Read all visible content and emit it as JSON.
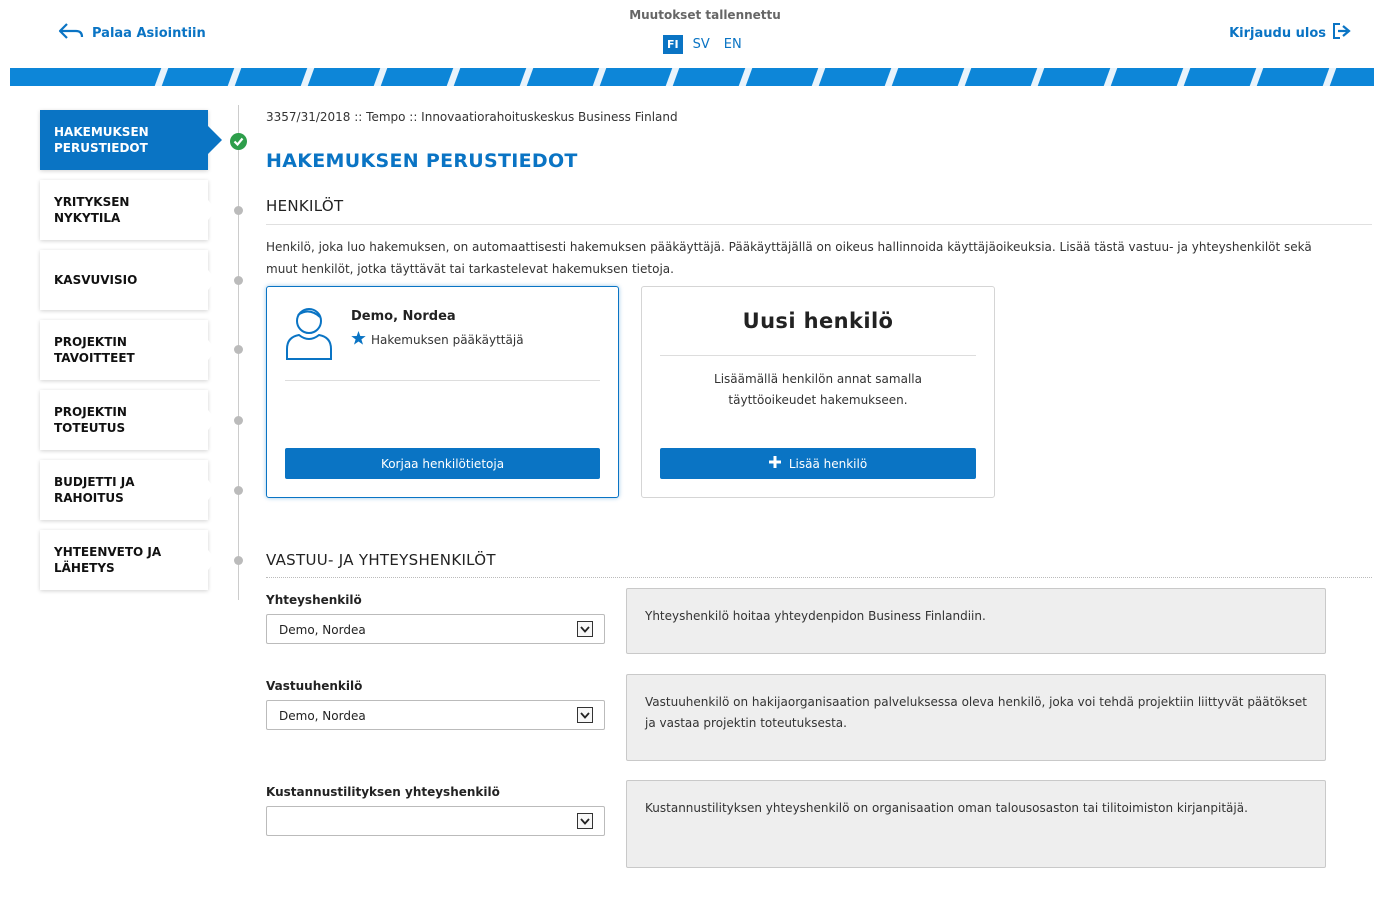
{
  "header": {
    "back_label": "Palaa Asiointiin",
    "save_status": "Muutokset tallennettu",
    "languages": [
      "FI",
      "SV",
      "EN"
    ],
    "active_language": "FI",
    "logout_label": "Kirjaudu ulos"
  },
  "colors": {
    "accent": "#0a74c4",
    "success": "#2e9e4b",
    "info_bg": "#eeeeee"
  },
  "sidebar": {
    "items": [
      {
        "label1": "HAKEMUKSEN",
        "label2": "PERUSTIEDOT",
        "active": true,
        "completed": true
      },
      {
        "label1": "YRITYKSEN",
        "label2": "NYKYTILA"
      },
      {
        "label1": "KASVUVISIO",
        "label2": ""
      },
      {
        "label1": "PROJEKTIN",
        "label2": "TAVOITTEET"
      },
      {
        "label1": "PROJEKTIN",
        "label2": "TOTEUTUS"
      },
      {
        "label1": "BUDJETTI JA",
        "label2": "RAHOITUS"
      },
      {
        "label1": "YHTEENVETO JA",
        "label2": "LÄHETYS"
      }
    ]
  },
  "main": {
    "breadcrumb": "3357/31/2018 :: Tempo :: Innovaatiorahoituskeskus Business Finland",
    "page_title": "HAKEMUKSEN PERUSTIEDOT",
    "persons_section": {
      "title": "HENKILÖT",
      "intro": "Henkilö, joka luo hakemuksen, on automaattisesti hakemuksen pääkäyttäjä. Pääkäyttäjällä on oikeus hallinnoida käyttäjäoikeuksia. Lisää tästä vastuu- ja yhteyshenkilöt sekä muut henkilöt, jotka täyttävät tai tarkastelevat hakemuksen tietoja.",
      "person_card": {
        "name": "Demo, Nordea",
        "role": "Hakemuksen pääkäyttäjä",
        "edit_label": "Korjaa henkilötietoja"
      },
      "new_card": {
        "title": "Uusi henkilö",
        "description": "Lisäämällä henkilön annat samalla täyttöoikeudet hakemukseen.",
        "add_label": "Lisää henkilö"
      }
    },
    "contacts_section": {
      "title": "VASTUU- JA YHTEYSHENKILÖT",
      "fields": [
        {
          "label": "Yhteyshenkilö",
          "value": "Demo, Nordea",
          "info": "Yhteyshenkilö hoitaa yhteydenpidon Business Finlandiin."
        },
        {
          "label": "Vastuuhenkilö",
          "value": "Demo, Nordea",
          "info": "Vastuuhenkilö on hakijaorganisaation palveluksessa oleva henkilö, joka voi tehdä projektiin liittyvät päätökset ja vastaa projektin toteutuksesta."
        },
        {
          "label": "Kustannustilityksen yhteyshenkilö",
          "value": "",
          "info": "Kustannustilityksen yhteyshenkilö on organisaation oman talousosaston tai tilitoimiston kirjanpitäjä."
        }
      ]
    }
  },
  "icons": {
    "back": "back-arrow-icon",
    "logout": "logout-icon",
    "avatar": "user-avatar-icon",
    "star": "star-icon",
    "plus": "plus-icon",
    "check": "check-icon",
    "dropdown": "chevron-down-icon"
  }
}
